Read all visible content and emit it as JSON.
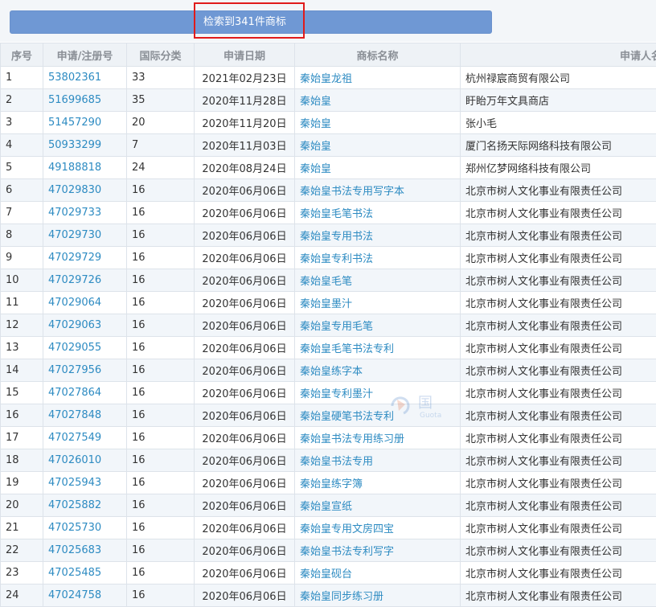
{
  "search": {
    "result_label": "检索到341件商标"
  },
  "table": {
    "headers": [
      "序号",
      "申请/注册号",
      "国际分类",
      "申请日期",
      "商标名称",
      "申请人名称"
    ],
    "rows": [
      {
        "no": "1",
        "reg": "53802361",
        "cls": "33",
        "date": "2021年02月23日",
        "name": "秦始皇龙祖",
        "applicant": "杭州禄宸商贸有限公司"
      },
      {
        "no": "2",
        "reg": "51699685",
        "cls": "35",
        "date": "2020年11月28日",
        "name": "秦始皇",
        "applicant": "盱眙万年文具商店"
      },
      {
        "no": "3",
        "reg": "51457290",
        "cls": "20",
        "date": "2020年11月20日",
        "name": "秦始皇",
        "applicant": "张小毛"
      },
      {
        "no": "4",
        "reg": "50933299",
        "cls": "7",
        "date": "2020年11月03日",
        "name": "秦始皇",
        "applicant": "厦门名扬天际网络科技有限公司"
      },
      {
        "no": "5",
        "reg": "49188818",
        "cls": "24",
        "date": "2020年08月24日",
        "name": "秦始皇",
        "applicant": "郑州亿梦网络科技有限公司"
      },
      {
        "no": "6",
        "reg": "47029830",
        "cls": "16",
        "date": "2020年06月06日",
        "name": "秦始皇书法专用写字本",
        "applicant": "北京市树人文化事业有限责任公司"
      },
      {
        "no": "7",
        "reg": "47029733",
        "cls": "16",
        "date": "2020年06月06日",
        "name": "秦始皇毛笔书法",
        "applicant": "北京市树人文化事业有限责任公司"
      },
      {
        "no": "8",
        "reg": "47029730",
        "cls": "16",
        "date": "2020年06月06日",
        "name": "秦始皇专用书法",
        "applicant": "北京市树人文化事业有限责任公司"
      },
      {
        "no": "9",
        "reg": "47029729",
        "cls": "16",
        "date": "2020年06月06日",
        "name": "秦始皇专利书法",
        "applicant": "北京市树人文化事业有限责任公司"
      },
      {
        "no": "10",
        "reg": "47029726",
        "cls": "16",
        "date": "2020年06月06日",
        "name": "秦始皇毛笔",
        "applicant": "北京市树人文化事业有限责任公司"
      },
      {
        "no": "11",
        "reg": "47029064",
        "cls": "16",
        "date": "2020年06月06日",
        "name": "秦始皇墨汁",
        "applicant": "北京市树人文化事业有限责任公司"
      },
      {
        "no": "12",
        "reg": "47029063",
        "cls": "16",
        "date": "2020年06月06日",
        "name": "秦始皇专用毛笔",
        "applicant": "北京市树人文化事业有限责任公司"
      },
      {
        "no": "13",
        "reg": "47029055",
        "cls": "16",
        "date": "2020年06月06日",
        "name": "秦始皇毛笔书法专利",
        "applicant": "北京市树人文化事业有限责任公司"
      },
      {
        "no": "14",
        "reg": "47027956",
        "cls": "16",
        "date": "2020年06月06日",
        "name": "秦始皇练字本",
        "applicant": "北京市树人文化事业有限责任公司"
      },
      {
        "no": "15",
        "reg": "47027864",
        "cls": "16",
        "date": "2020年06月06日",
        "name": "秦始皇专利墨汁",
        "applicant": "北京市树人文化事业有限责任公司"
      },
      {
        "no": "16",
        "reg": "47027848",
        "cls": "16",
        "date": "2020年06月06日",
        "name": "秦始皇硬笔书法专利",
        "applicant": "北京市树人文化事业有限责任公司"
      },
      {
        "no": "17",
        "reg": "47027549",
        "cls": "16",
        "date": "2020年06月06日",
        "name": "秦始皇书法专用练习册",
        "applicant": "北京市树人文化事业有限责任公司"
      },
      {
        "no": "18",
        "reg": "47026010",
        "cls": "16",
        "date": "2020年06月06日",
        "name": "秦始皇书法专用",
        "applicant": "北京市树人文化事业有限责任公司"
      },
      {
        "no": "19",
        "reg": "47025943",
        "cls": "16",
        "date": "2020年06月06日",
        "name": "秦始皇练字簿",
        "applicant": "北京市树人文化事业有限责任公司"
      },
      {
        "no": "20",
        "reg": "47025882",
        "cls": "16",
        "date": "2020年06月06日",
        "name": "秦始皇宣纸",
        "applicant": "北京市树人文化事业有限责任公司"
      },
      {
        "no": "21",
        "reg": "47025730",
        "cls": "16",
        "date": "2020年06月06日",
        "name": "秦始皇专用文房四宝",
        "applicant": "北京市树人文化事业有限责任公司"
      },
      {
        "no": "22",
        "reg": "47025683",
        "cls": "16",
        "date": "2020年06月06日",
        "name": "秦始皇书法专利写字",
        "applicant": "北京市树人文化事业有限责任公司"
      },
      {
        "no": "23",
        "reg": "47025485",
        "cls": "16",
        "date": "2020年06月06日",
        "name": "秦始皇砚台",
        "applicant": "北京市树人文化事业有限责任公司"
      },
      {
        "no": "24",
        "reg": "47024758",
        "cls": "16",
        "date": "2020年06月06日",
        "name": "秦始皇同步练习册",
        "applicant": "北京市树人文化事业有限责任公司"
      }
    ]
  },
  "watermark": {
    "text_cn": "国",
    "text_en": "Guota",
    "logo_icon": "guotao-logo-icon"
  },
  "colors": {
    "link": "#2d8bc2",
    "result_bar": "#6f98d4",
    "highlight_border": "#e01b1b",
    "row_alt": "#f2f6fa"
  }
}
